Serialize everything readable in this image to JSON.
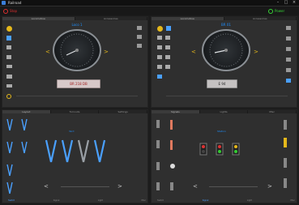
{
  "window": {
    "title": "Railroad",
    "controls": [
      "–",
      "□",
      "×"
    ]
  },
  "toolbar": {
    "stop_label": "Stop",
    "power_label": "Power"
  },
  "loco_left": {
    "tabs": [
      "Locomotive",
      "Accessories"
    ],
    "name": "Loco 1",
    "plate": "BR 218 DB",
    "left_arrow": "<",
    "right_arrow": ">",
    "speed_label_left": "",
    "speed_label_right": "",
    "accent": "#1e90ff"
  },
  "loco_right": {
    "tabs": [
      "Locomotive",
      "Accessories"
    ],
    "name": "BR 01",
    "plate": "E 94",
    "left_arrow": "<",
    "right_arrow": ">",
    "accent": "#1e90ff"
  },
  "bottom_left": {
    "tabs": [
      "Layout",
      "Turnouts",
      "Settings"
    ],
    "center_label": "Yard",
    "left_arrow": "<",
    "right_arrow": ">",
    "footer": [
      "Switch",
      "Signal",
      "Light",
      "Misc"
    ]
  },
  "bottom_right": {
    "tabs": [
      "Signals",
      "Lights",
      "Misc"
    ],
    "center_label": "Station",
    "left_arrow": "<",
    "right_arrow": ">",
    "footer": [
      "Switch",
      "Signal",
      "Light",
      "Misc"
    ]
  },
  "colors": {
    "stop": "#e03030",
    "power": "#37d337",
    "accent": "#1e90ff",
    "arrow": "#e5b81b"
  }
}
